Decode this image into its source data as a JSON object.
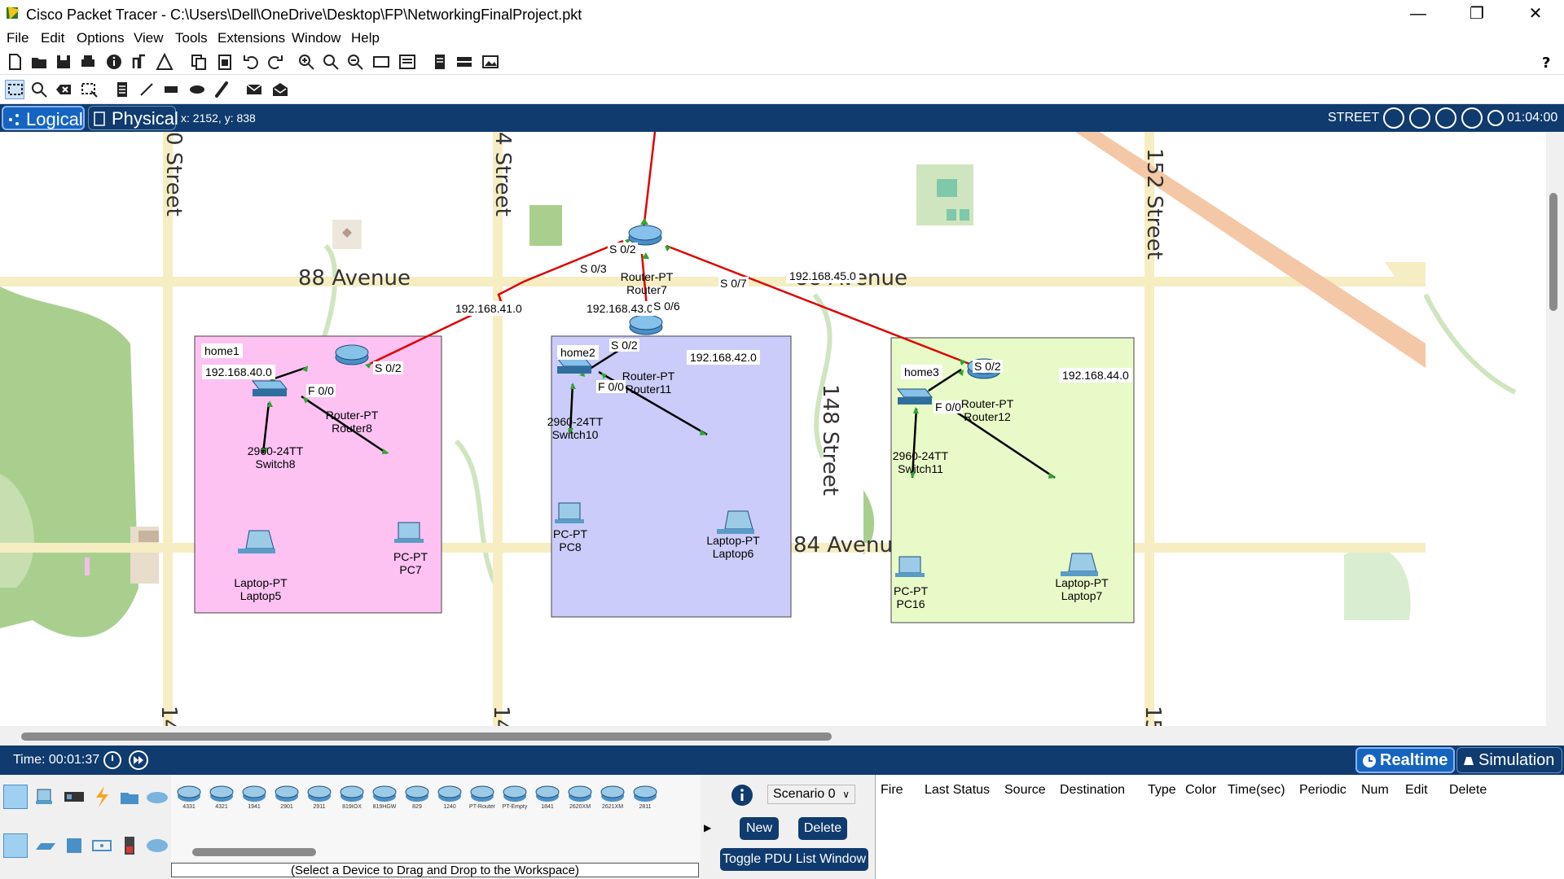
{
  "window": {
    "title": "Cisco Packet Tracer - C:\\Users\\Dell\\OneDrive\\Desktop\\FP\\NetworkingFinalProject.pkt"
  },
  "menu": [
    "File",
    "Edit",
    "Options",
    "View",
    "Tools",
    "Extensions",
    "Window",
    "Help"
  ],
  "modebar": {
    "logical": "Logical",
    "physical": "Physical",
    "coords": "x: 2152, y: 838",
    "street": "STREET",
    "clock": "01:04:00"
  },
  "streets": [
    "0 Street",
    "4 Street",
    "152 Street",
    "88 Avenue",
    "88 Avenue",
    "148 Street",
    "84 Avenu",
    "14",
    "14",
    "15"
  ],
  "topology": {
    "areas": [
      "home1",
      "home2",
      "home3"
    ],
    "networks": [
      "192.168.40.0",
      "192.168.41.0",
      "192.168.42.0",
      "192.168.43.0",
      "192.168.44.0",
      "192.168.45.0"
    ],
    "interfaces": [
      "S 0/2",
      "S 0/3",
      "S 0/7",
      "S 0/6",
      "S 0/2",
      "F 0/0",
      "S 0/2",
      "F 0/0",
      "S 0/2",
      "F 0/0"
    ],
    "devices": [
      {
        "type": "Router-PT",
        "name": "Router7"
      },
      {
        "type": "Router-PT",
        "name": "Router8"
      },
      {
        "type": "Router-PT",
        "name": "Router11"
      },
      {
        "type": "Router-PT",
        "name": "Router12"
      },
      {
        "type": "2960-24TT",
        "name": "Switch8"
      },
      {
        "type": "2960-24TT",
        "name": "Switch10"
      },
      {
        "type": "2960-24TT",
        "name": "Switch11"
      },
      {
        "type": "Laptop-PT",
        "name": "Laptop5"
      },
      {
        "type": "PC-PT",
        "name": "PC7"
      },
      {
        "type": "PC-PT",
        "name": "PC8"
      },
      {
        "type": "Laptop-PT",
        "name": "Laptop6"
      },
      {
        "type": "PC-PT",
        "name": "PC16"
      },
      {
        "type": "Laptop-PT",
        "name": "Laptop7"
      }
    ]
  },
  "simbar": {
    "time": "Time: 00:01:37",
    "realtime": "Realtime",
    "simulation": "Simulation"
  },
  "device_models": [
    "4331",
    "4321",
    "1941",
    "2901",
    "2911",
    "819IOX",
    "819HGW",
    "829",
    "1240",
    "PT-Router",
    "PT-Empty",
    "1841",
    "2620XM",
    "2621XM",
    "2811"
  ],
  "device_hint": "(Select a Device to Drag and Drop to the Workspace)",
  "pdu": {
    "scenario": "Scenario 0",
    "new": "New",
    "delete": "Delete",
    "toggle": "Toggle PDU List Window"
  },
  "pdu_columns": [
    "Fire",
    "Last Status",
    "Source",
    "Destination",
    "Type",
    "Color",
    "Time(sec)",
    "Periodic",
    "Num",
    "Edit",
    "Delete"
  ]
}
